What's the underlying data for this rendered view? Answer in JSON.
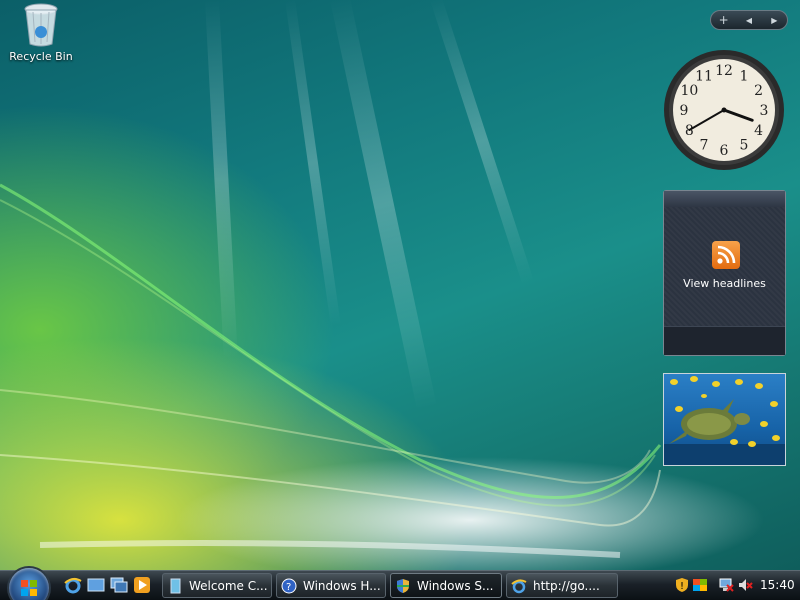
{
  "desktop": {
    "recycle_bin_label": "Recycle Bin"
  },
  "sidebar": {
    "add_gadget": "+",
    "prev": "◀",
    "next": "▶",
    "feed_gadget": {
      "text": "View headlines"
    },
    "clock": {
      "hour": 3,
      "minute": 40,
      "numerals": [
        "12",
        "1",
        "2",
        "3",
        "4",
        "5",
        "6",
        "7",
        "8",
        "9",
        "10",
        "11"
      ]
    }
  },
  "taskbar": {
    "quick_launch": [
      "internet-explorer-icon",
      "show-desktop-icon",
      "switch-windows-icon",
      "media-player-icon"
    ],
    "tasks": [
      {
        "label": "Welcome C...",
        "icon": "welcome-center-icon",
        "active": false
      },
      {
        "label": "Windows H...",
        "icon": "help-icon",
        "active": false
      },
      {
        "label": "Windows S...",
        "icon": "security-center-icon",
        "active": true
      },
      {
        "label": "http://go....",
        "icon": "internet-explorer-icon",
        "active": false
      }
    ],
    "tray": [
      "security-warning-icon",
      "windows-update-icon",
      "network-disconnected-icon",
      "volume-muted-icon"
    ],
    "clock": "15:40"
  }
}
